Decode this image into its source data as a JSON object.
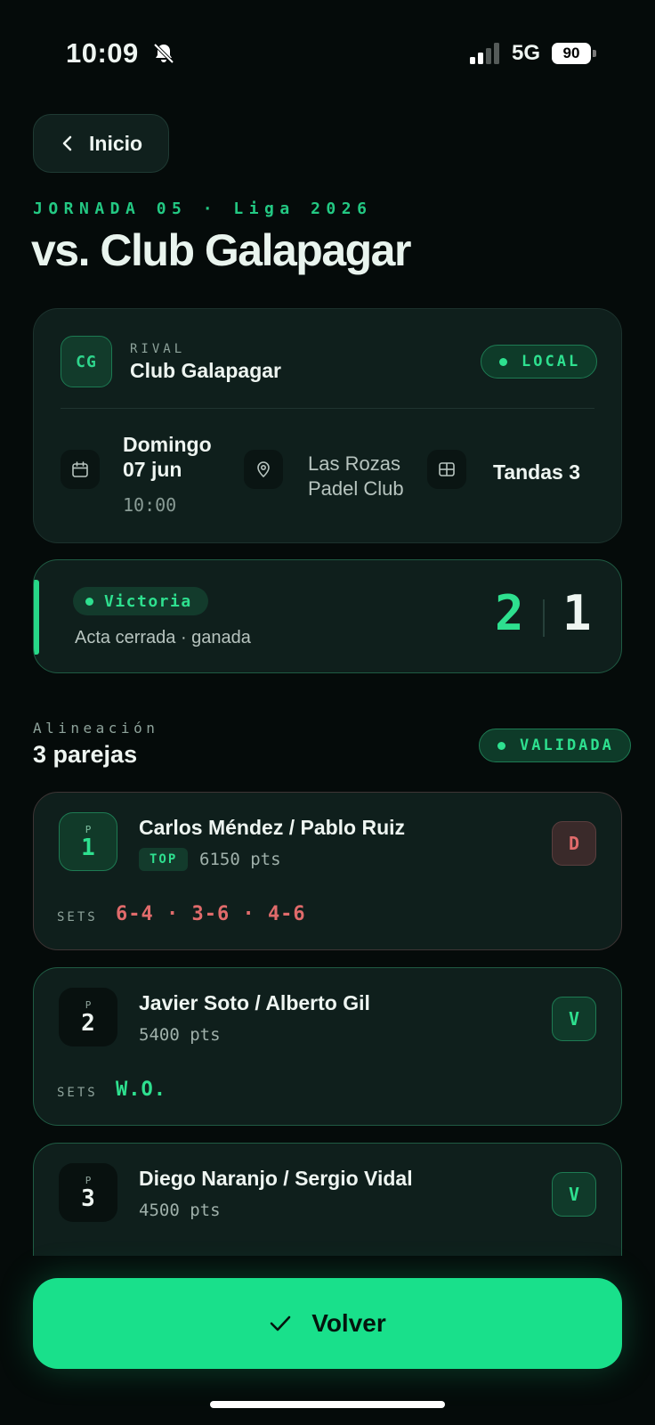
{
  "status_bar": {
    "time": "10:09",
    "network": "5G",
    "battery": "90",
    "icons": [
      "bell-slash-icon",
      "signal-icon",
      "battery-icon"
    ]
  },
  "header": {
    "back_label": "Inicio",
    "eyebrow": "JORNADA 05 · Liga 2026",
    "title": "vs. Club Galapagar"
  },
  "match": {
    "rival_initials": "CG",
    "rival_label": "RIVAL",
    "rival_name": "Club Galapagar",
    "venue_type": "LOCAL",
    "day": "Domingo",
    "date": "07 jun",
    "time": "10:00",
    "venue_line1": "Las Rozas",
    "venue_line2": "Padel Club",
    "tandas": "Tandas 3",
    "icons": [
      "calendar-icon",
      "location-pin-icon",
      "grid-icon"
    ]
  },
  "result": {
    "status": "Victoria",
    "summary": "Acta cerrada · ganada",
    "home_score": "2",
    "away_score": "1"
  },
  "lineup": {
    "label": "Alineación",
    "count": "3 parejas",
    "status": "VALIDADA",
    "sets_label": "SETS",
    "position_prefix": "P",
    "pairs": [
      {
        "position": "1",
        "names": "Carlos Méndez / Pablo Ruiz",
        "tag": "TOP",
        "points": "6150 pts",
        "result": "D",
        "sets": "6-4 · 3-6 · 4-6"
      },
      {
        "position": "2",
        "names": "Javier Soto / Alberto Gil",
        "points": "5400 pts",
        "result": "V",
        "sets": "W.O."
      },
      {
        "position": "3",
        "names": "Diego Naranjo / Sergio Vidal",
        "points": "4500 pts",
        "result": "V"
      }
    ]
  },
  "footer": {
    "cta_label": "Volver",
    "cta_icon": "check-icon"
  },
  "colors": {
    "background": "#050b0a",
    "accent": "#19e08b",
    "loss": "#e06b6b",
    "card": "#0f1f1c"
  }
}
